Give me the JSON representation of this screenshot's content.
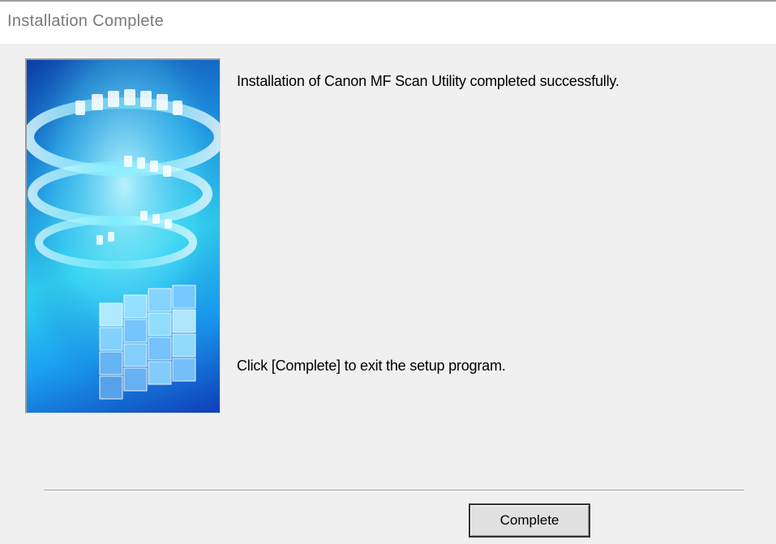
{
  "window": {
    "title": "Installation Complete"
  },
  "banner": {
    "icon": "canon-installer-graphic"
  },
  "messages": {
    "success": "Installation of Canon MF Scan Utility completed successfully.",
    "exit_hint": "Click [Complete] to exit the setup program."
  },
  "buttons": {
    "complete_label": "Complete"
  },
  "colors": {
    "header_background": "#ffffff",
    "dialog_background": "#f0f0f0",
    "title_text": "#7a7a7a"
  }
}
